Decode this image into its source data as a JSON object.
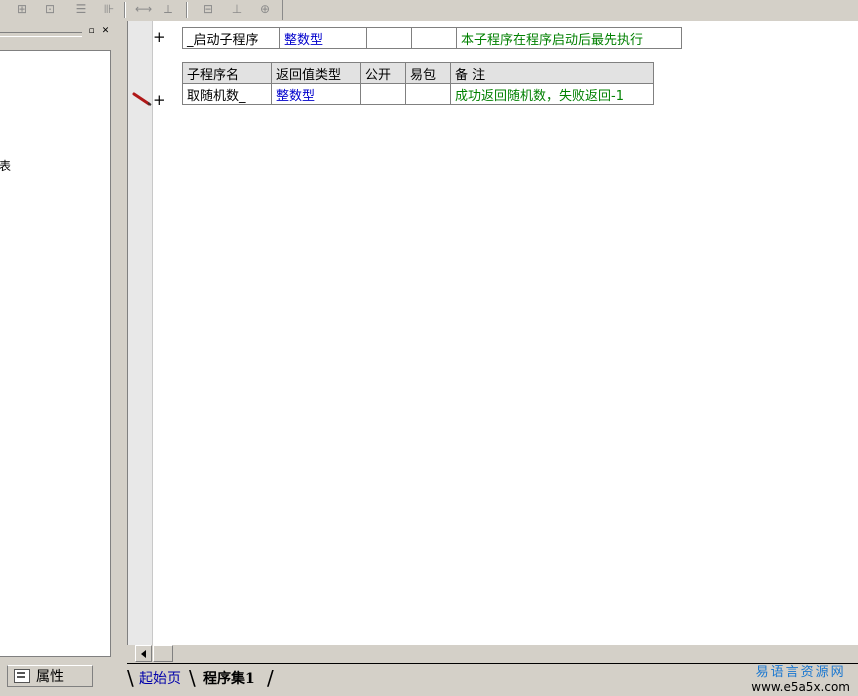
{
  "toolbar": {
    "icons": [
      "table-insert-icon",
      "table-split-icon",
      "table-merge-icon",
      "table-align-icon",
      "width-equal-icon",
      "height-equal-icon",
      "fit-width-icon",
      "fit-height-icon",
      "fit-both-icon"
    ]
  },
  "left_panel": {
    "tree_partial_text": "表",
    "properties_tab_label": "属性"
  },
  "startup_table": {
    "row": {
      "name": "_启动子程序",
      "return_type": "整数型",
      "public": "",
      "package": "",
      "note": "本子程序在程序启动后最先执行"
    }
  },
  "sub_table": {
    "headers": {
      "name": "子程序名",
      "return_type": "返回值类型",
      "public": "公开",
      "package": "易包",
      "note": "备 注"
    },
    "row": {
      "name": "取随机数_",
      "return_type": "整数型",
      "public": "",
      "package": "",
      "note": "成功返回随机数，失败返回-1"
    }
  },
  "gutter": {
    "plus_symbol": "+"
  },
  "tabs": {
    "start_label": "起始页",
    "active_label": "程序集1"
  },
  "watermark": {
    "line1": "易语言资源网",
    "line2": "www.e5a5x.com"
  },
  "colors": {
    "type_blue": "#0000cc",
    "note_green": "#008000",
    "header_gray": "#e2e2e2",
    "pencil_red": "#b01818"
  }
}
